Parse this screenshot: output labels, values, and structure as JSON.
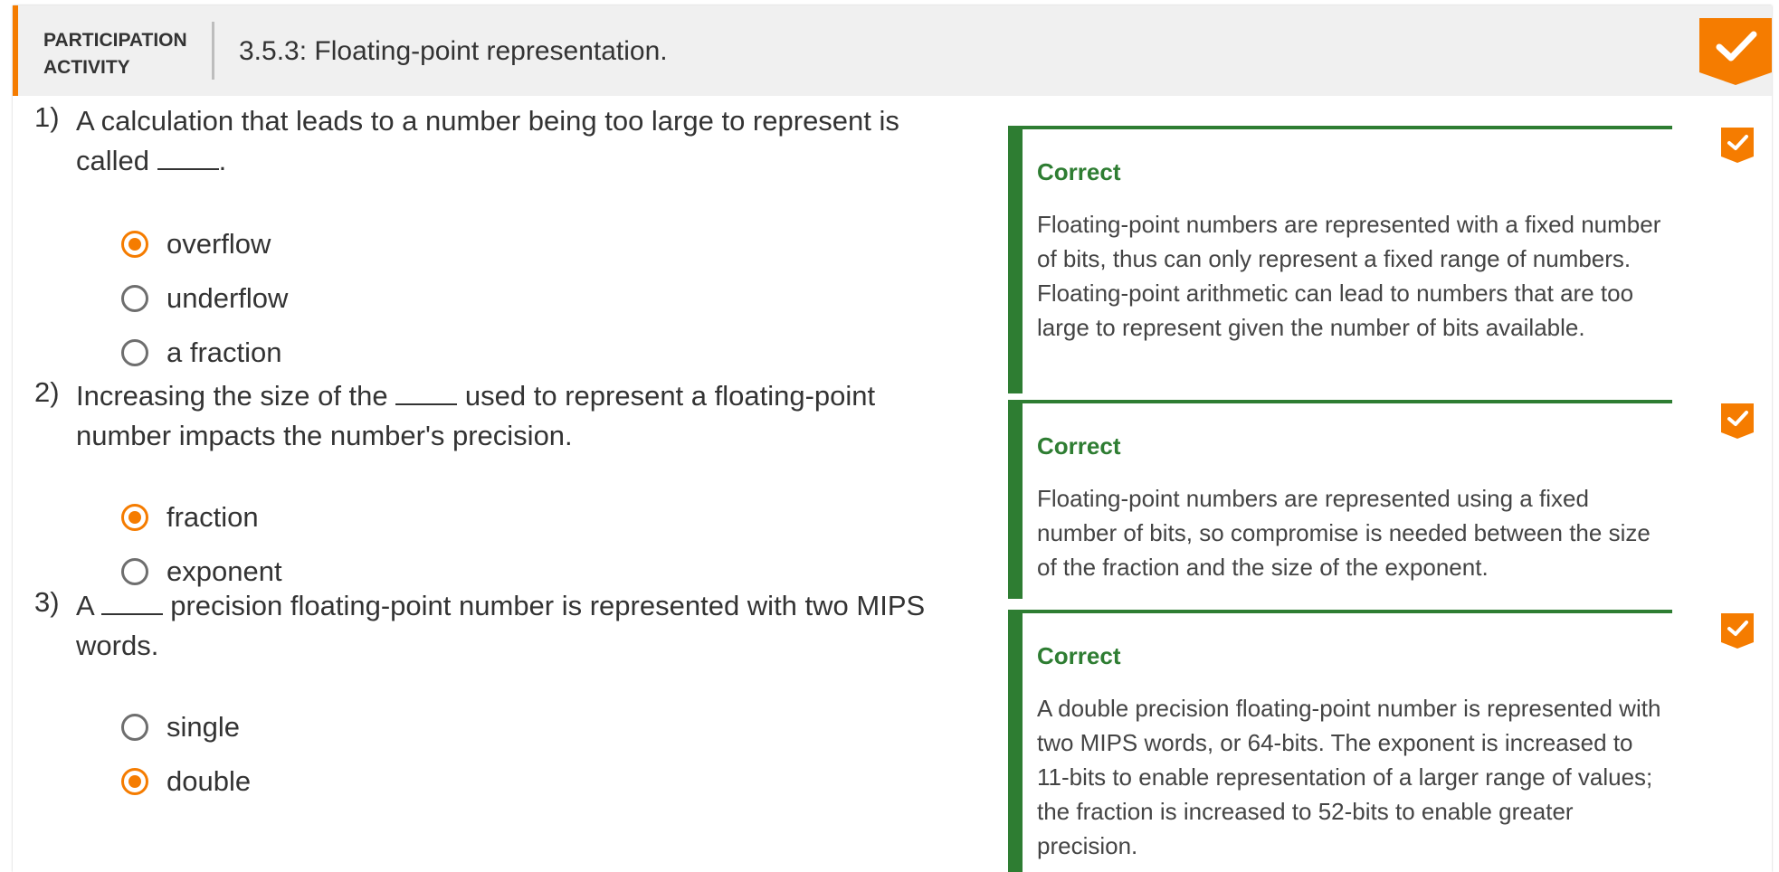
{
  "header": {
    "tag": "PARTICIPATION ACTIVITY",
    "title": "3.5.3: Floating-point representation."
  },
  "questions": [
    {
      "number": "1)",
      "text_before": "A calculation that leads to a number being too large to represent is called",
      "text_after": ".",
      "options": [
        "overflow",
        "underflow",
        "a fraction"
      ],
      "selected": 0,
      "feedback_title": "Correct",
      "feedback_text": "Floating-point numbers are represented with a fixed number of bits, thus can only represent a fixed range of numbers. Floating-point arithmetic can lead to numbers that are too large to represent given the number of bits available."
    },
    {
      "number": "2)",
      "text_before": "Increasing the size of the",
      "text_after": "used to represent a floating-point number impacts the number's precision.",
      "options": [
        "fraction",
        "exponent"
      ],
      "selected": 0,
      "feedback_title": "Correct",
      "feedback_text": "Floating-point numbers are represented using a fixed number of bits, so compromise is needed between the size of the fraction and the size of the exponent."
    },
    {
      "number": "3)",
      "text_before": "A",
      "text_after": "precision floating-point number is represented with two MIPS words.",
      "options": [
        "single",
        "double"
      ],
      "selected": 1,
      "feedback_title": "Correct",
      "feedback_text": "A double precision floating-point number is represented with two MIPS words, or 64-bits. The exponent is increased to 11-bits to enable representation of a larger range of values; the fraction is increased to 52-bits to enable greater precision."
    }
  ],
  "colors": {
    "accent": "#f57c00",
    "correct": "#2e7d32"
  }
}
